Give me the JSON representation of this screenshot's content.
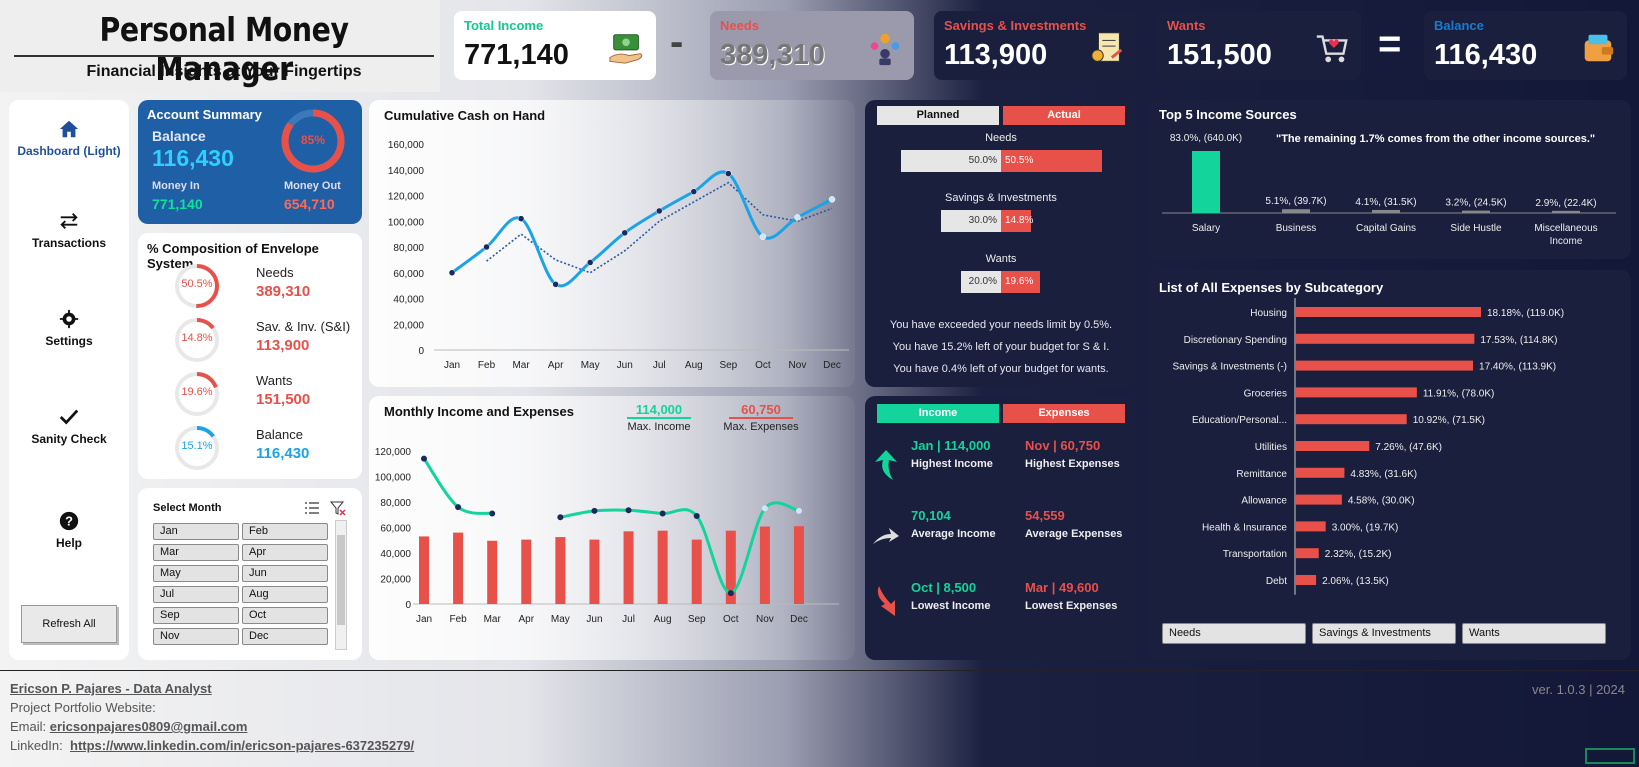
{
  "header": {
    "title": "Personal Money Manager",
    "subtitle": "Financial Insights at Your Fingertips",
    "op_minus": "-",
    "op_equals": "=",
    "kpis": [
      {
        "label": "Total Income",
        "value": "771,140",
        "icon": "money-hand-icon"
      },
      {
        "label": "Needs",
        "value": "389,310",
        "icon": "needs-people-icon"
      },
      {
        "label": "Savings & Investments",
        "value": "113,900",
        "icon": "savings-document-icon"
      },
      {
        "label": "Wants",
        "value": "151,500",
        "icon": "shopping-cart-heart-icon"
      },
      {
        "label": "Balance",
        "value": "116,430",
        "icon": "wallet-icon"
      }
    ]
  },
  "nav": {
    "items": [
      {
        "label": "Dashboard (Light)",
        "icon": "home-icon"
      },
      {
        "label": "Transactions",
        "icon": "transfer-arrows-icon"
      },
      {
        "label": "Settings",
        "icon": "gear-icon"
      },
      {
        "label": "Sanity Check",
        "icon": "check-icon"
      },
      {
        "label": "Help",
        "icon": "question-icon"
      }
    ],
    "refresh_label": "Refresh All"
  },
  "account": {
    "title": "Account Summary",
    "balance_label": "Balance",
    "balance_value": "116,430",
    "ring_pct": "85%",
    "ring_fraction": 0.85,
    "money_in_label": "Money In",
    "money_in_value": "771,140",
    "money_out_label": "Money Out",
    "money_out_value": "654,710"
  },
  "envelope": {
    "title": "% Composition of Envelope System",
    "rows": [
      {
        "pct": "50.5%",
        "fraction": 0.505,
        "label": "Needs",
        "value": "389,310",
        "color": "#e8504a"
      },
      {
        "pct": "14.8%",
        "fraction": 0.148,
        "label": "Sav. & Inv. (S&I)",
        "value": "113,900",
        "color": "#e8504a"
      },
      {
        "pct": "19.6%",
        "fraction": 0.196,
        "label": "Wants",
        "value": "151,500",
        "color": "#e8504a"
      },
      {
        "pct": "15.1%",
        "fraction": 0.151,
        "label": "Balance",
        "value": "116,430",
        "color": "#1aa3e8"
      }
    ]
  },
  "slicer": {
    "title": "Select Month",
    "months": [
      "Jan",
      "Feb",
      "Mar",
      "Apr",
      "May",
      "Jun",
      "Jul",
      "Aug",
      "Sep",
      "Oct",
      "Nov",
      "Dec"
    ]
  },
  "planned_actual": {
    "planned_label": "Planned",
    "actual_label": "Actual",
    "rows": [
      {
        "label": "Needs",
        "planned": "50.0%",
        "actual": "50.5%",
        "planned_frac": 0.5,
        "actual_frac": 0.505
      },
      {
        "label": "Savings & Investments",
        "planned": "30.0%",
        "actual": "14.8%",
        "planned_frac": 0.3,
        "actual_frac": 0.148
      },
      {
        "label": "Wants",
        "planned": "20.0%",
        "actual": "19.6%",
        "planned_frac": 0.2,
        "actual_frac": 0.196
      }
    ],
    "notes": [
      "You have exceeded your needs limit by 0.5%.",
      "You have 15.2% left of your budget for S & I.",
      "You have 0.4% left of your budget for wants."
    ]
  },
  "income_expenses": {
    "income_label": "Income",
    "expenses_label": "Expenses",
    "highest_income_value": "Jan | 114,000",
    "highest_income_label": "Highest Income",
    "highest_expenses_value": "Nov | 60,750",
    "highest_expenses_label": "Highest Expenses",
    "average_income_value": "70,104",
    "average_income_label": "Average Income",
    "average_expenses_value": "54,559",
    "average_expenses_label": "Average Expenses",
    "lowest_income_value": "Oct | 8,500",
    "lowest_income_label": "Lowest Income",
    "lowest_expenses_value": "Mar | 49,600",
    "lowest_expenses_label": "Lowest Expenses"
  },
  "top5": {
    "title": "Top 5 Income Sources",
    "note": "\"The remaining 1.7% comes from the other income sources.\""
  },
  "expenses_list": {
    "title": "List of All Expenses by Subcategory",
    "tabs": [
      "Needs",
      "Savings & Investments",
      "Wants"
    ]
  },
  "monthly": {
    "title": "Monthly Income and Expenses",
    "max_income": "114,000",
    "max_income_label": "Max. Income",
    "max_expenses": "60,750",
    "max_expenses_label": "Max. Expenses"
  },
  "footer": {
    "author": "Ericson P. Pajares - Data Analyst",
    "portfolio_label": "Project Portfolio Website:",
    "email_label": "Email:",
    "email": "ericsonpajares0809@gmail.com",
    "linkedin_label": "LinkedIn:",
    "linkedin": "https://www.linkedin.com/in/ericson-pajares-637235279/",
    "version": "ver. 1.0.3 | 2024"
  },
  "chart_data": [
    {
      "type": "line",
      "title": "Cumulative Cash on Hand",
      "x": [
        "Jan",
        "Feb",
        "Mar",
        "Apr",
        "May",
        "Jun",
        "Jul",
        "Aug",
        "Sep",
        "Oct",
        "Nov",
        "Dec"
      ],
      "series": [
        {
          "values": [
            60000,
            80000,
            102000,
            51000,
            68000,
            91000,
            108000,
            123000,
            137000,
            88000,
            103000,
            117000
          ]
        }
      ],
      "trend": [
        null,
        69000,
        90000,
        70000,
        60000,
        77000,
        100000,
        115000,
        130000,
        105000,
        100000,
        110000
      ],
      "ylim": [
        0,
        160000
      ],
      "yticks": [
        "0",
        "20,000",
        "40,000",
        "60,000",
        "80,000",
        "100,000",
        "120,000",
        "140,000",
        "160,000"
      ],
      "color": "#1aa3e8"
    },
    {
      "type": "bar",
      "title": "Monthly Income and Expenses",
      "categories": [
        "Jan",
        "Feb",
        "Mar",
        "Apr",
        "May",
        "Jun",
        "Jul",
        "Aug",
        "Sep",
        "Oct",
        "Nov",
        "Dec"
      ],
      "series": [
        {
          "values": [
            53000,
            56000,
            49600,
            50500,
            52500,
            50500,
            57000,
            57500,
            50500,
            57500,
            60750,
            61000
          ],
          "color": "#e8504a"
        },
        {
          "values": [
            114000,
            76000,
            71000,
            null,
            68000,
            73000,
            73500,
            71000,
            69000,
            8500,
            75000,
            73000
          ],
          "color": "#13d49a"
        }
      ],
      "ylim": [
        0,
        120000
      ],
      "yticks": [
        "0",
        "20,000",
        "40,000",
        "60,000",
        "80,000",
        "100,000",
        "120,000"
      ]
    },
    {
      "type": "bar",
      "title": "Top 5 Income Sources",
      "categories": [
        "Salary",
        "Business",
        "Capital Gains",
        "Side Hustle",
        "Miscellaneous Income"
      ],
      "values": [
        83.0,
        5.1,
        4.1,
        3.2,
        2.9
      ],
      "labels": [
        "83.0%, (640.0K)",
        "5.1%, (39.7K)",
        "4.1%, (31.5K)",
        "3.2%, (24.5K)",
        "2.9%, (22.4K)"
      ]
    },
    {
      "type": "bar",
      "title": "List of All Expenses by Subcategory",
      "categories": [
        "Housing",
        "Discretionary Spending",
        "Savings & Investments (-)",
        "Groceries",
        "Education/Personal...",
        "Utilities",
        "Remittance",
        "Allowance",
        "Health & Insurance",
        "Transportation",
        "Debt"
      ],
      "values": [
        18.18,
        17.53,
        17.4,
        11.91,
        10.92,
        7.26,
        4.83,
        4.58,
        3.0,
        2.32,
        2.06
      ],
      "labels": [
        "18.18%, (119.0K)",
        "17.53%, (114.8K)",
        "17.40%, (113.9K)",
        "11.91%, (78.0K)",
        "10.92%, (71.5K)",
        "7.26%, (47.6K)",
        "4.83%, (31.6K)",
        "4.58%, (30.0K)",
        "3.00%, (19.7K)",
        "2.32%, (15.2K)",
        "2.06%, (13.5K)"
      ]
    }
  ]
}
